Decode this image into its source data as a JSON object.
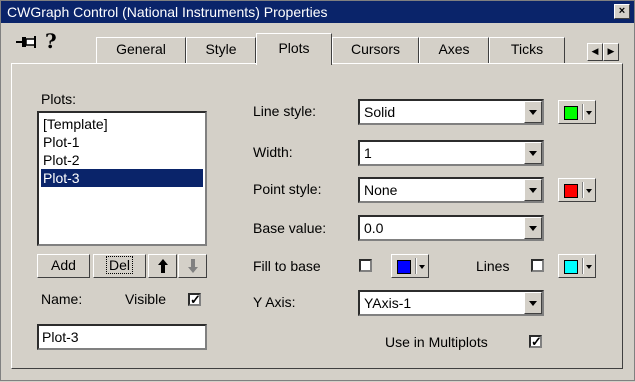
{
  "window": {
    "title": "CWGraph Control  (National Instruments) Properties",
    "close_label": "×"
  },
  "tabs": [
    {
      "label": "General"
    },
    {
      "label": "Style"
    },
    {
      "label": "Plots"
    },
    {
      "label": "Cursors"
    },
    {
      "label": "Axes"
    },
    {
      "label": "Ticks"
    }
  ],
  "active_tab": "Plots",
  "plots": {
    "label": "Plots:",
    "items": [
      "[Template]",
      "Plot-1",
      "Plot-2",
      "Plot-3"
    ],
    "selected": "Plot-3",
    "add_label": "Add",
    "del_label": "Del",
    "name_label": "Name:",
    "visible_label": "Visible",
    "visible_checked": true,
    "name_value": "Plot-3"
  },
  "props": {
    "line_style": {
      "label": "Line style:",
      "value": "Solid",
      "color": "#00ff00"
    },
    "width": {
      "label": "Width:",
      "value": "1"
    },
    "point_style": {
      "label": "Point style:",
      "value": "None",
      "color": "#ff0000"
    },
    "base_value": {
      "label": "Base value:",
      "value": "0.0"
    },
    "fill_to_base": {
      "label": "Fill to base",
      "checked": false,
      "color": "#0000ff"
    },
    "lines": {
      "label": "Lines",
      "checked": false,
      "color": "#00ffff"
    },
    "y_axis": {
      "label": "Y Axis:",
      "value": "YAxis-1"
    },
    "use_in_multiplots": {
      "label": "Use in Multiplots",
      "checked": true
    }
  }
}
